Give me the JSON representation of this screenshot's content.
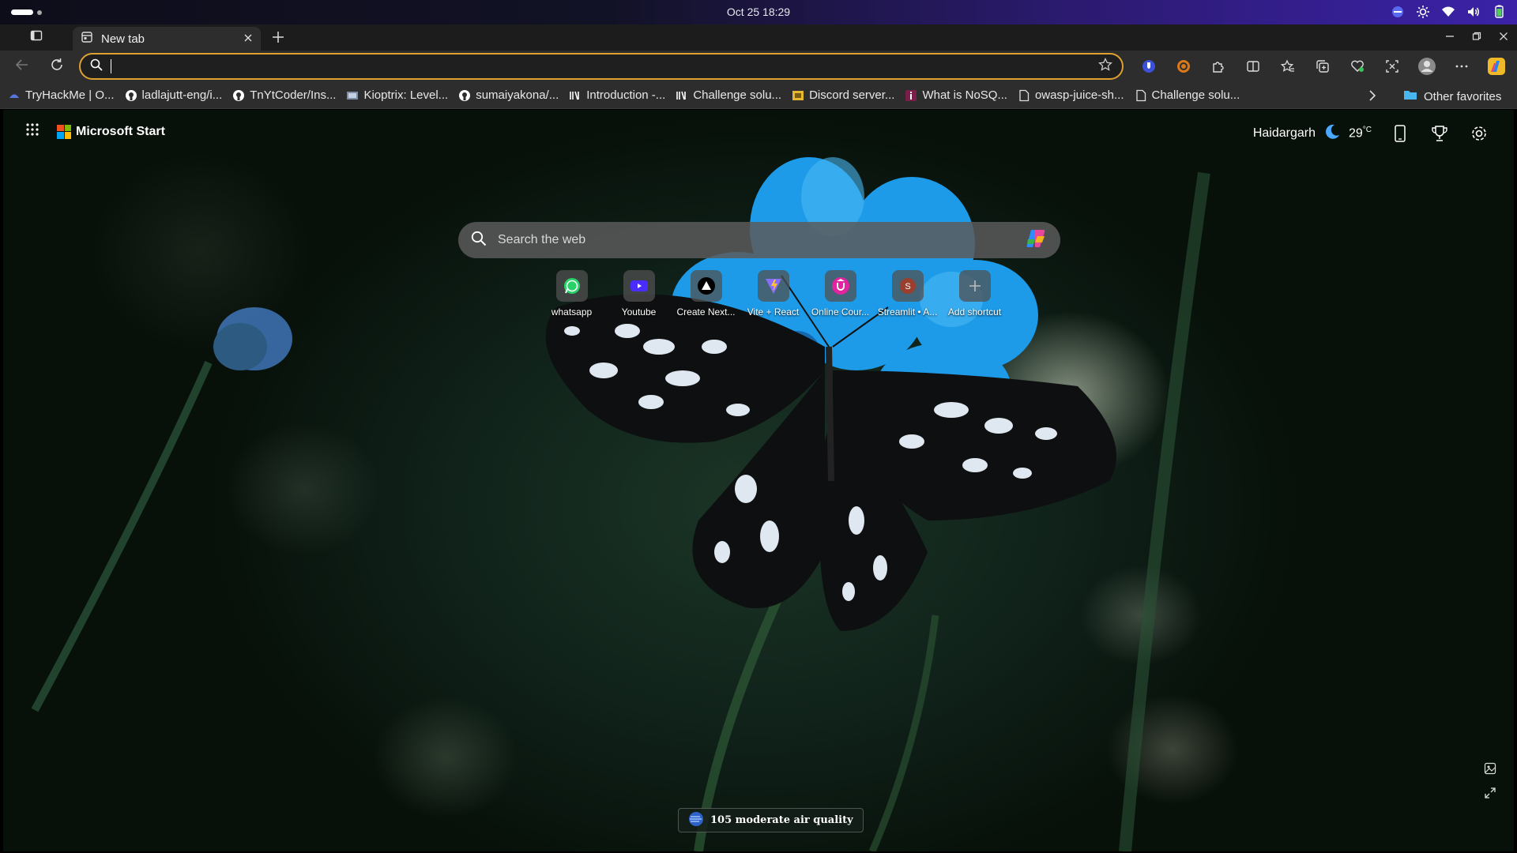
{
  "os": {
    "datetime": "Oct 25  18:29"
  },
  "tabs": [
    {
      "title": "New tab"
    }
  ],
  "address_bar": {
    "value": ""
  },
  "bookmarks": [
    {
      "label": "TryHackMe | O...",
      "icon": "tryhackme-icon"
    },
    {
      "label": "ladlajutt-eng/i...",
      "icon": "github-icon"
    },
    {
      "label": "TnYtCoder/Ins...",
      "icon": "github-icon"
    },
    {
      "label": "Kioptrix: Level...",
      "icon": "vulnhub-icon"
    },
    {
      "label": "sumaiyakona/...",
      "icon": "github-icon"
    },
    {
      "label": "Introduction -...",
      "icon": "mdn-icon"
    },
    {
      "label": "Challenge solu...",
      "icon": "mdn-icon"
    },
    {
      "label": "Discord server...",
      "icon": "discord-icon"
    },
    {
      "label": "What is NoSQ...",
      "icon": "info-icon"
    },
    {
      "label": "owasp-juice-sh...",
      "icon": "page-icon"
    },
    {
      "label": "Challenge solu...",
      "icon": "page-icon"
    }
  ],
  "other_favorites": "Other favorites",
  "ms_start": {
    "brand": "Microsoft Start",
    "location": "Haidargarh",
    "temperature": "29",
    "unit": "°C"
  },
  "search": {
    "placeholder": "Search the web"
  },
  "shortcuts": [
    {
      "label": "whatsapp",
      "icon": "whatsapp-icon"
    },
    {
      "label": "Youtube",
      "icon": "youtube-icon"
    },
    {
      "label": "Create Next...",
      "icon": "nextjs-icon"
    },
    {
      "label": "Vite + React",
      "icon": "vite-icon"
    },
    {
      "label": "Online Cour...",
      "icon": "udemy-icon"
    },
    {
      "label": "Streamlit • A...",
      "icon": "streamlit-icon"
    },
    {
      "label": "Add shortcut",
      "icon": "plus-icon"
    }
  ],
  "air_quality": "105 moderate air quality",
  "colors": {
    "address_focus": "#e0a030",
    "page_bg": "#10221a",
    "flower": "#1e9be8"
  }
}
